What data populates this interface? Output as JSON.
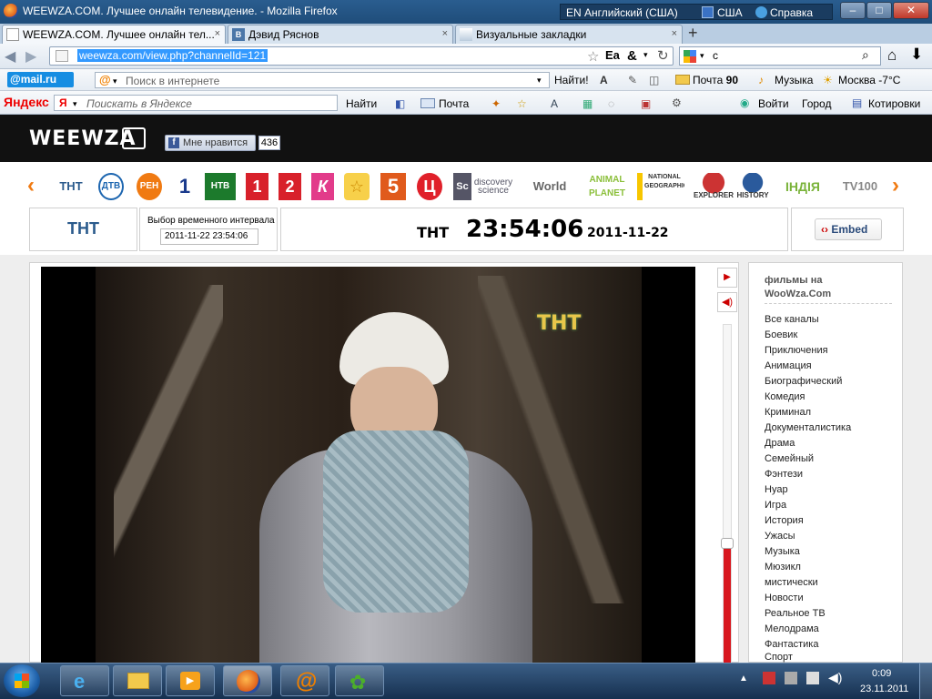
{
  "window": {
    "title": "WEEWZA.COM. Лучшее онлайн телевидение. - Mozilla Firefox",
    "lang_code": "EN",
    "lang_name": "Английский (США)",
    "region": "США",
    "help": "Справка",
    "minimize": "–",
    "maximize": "□",
    "close": "✕"
  },
  "tabs": [
    {
      "label": "WEEWZA.COM. Лучшее онлайн тел...",
      "icon": "page-icon"
    },
    {
      "label": "Дэвид Ряснов",
      "icon": "vk-icon"
    },
    {
      "label": "Визуальные закладки",
      "icon": "bookmarks-icon"
    }
  ],
  "tab_close": "×",
  "new_tab": "+",
  "nav": {
    "url": "weewza.com/view.php?channelId=121",
    "search_value": "c"
  },
  "mailbar": {
    "brand": "@mail.ru",
    "search_placeholder": "Поиск в интернете",
    "find": "Найти!",
    "mail": "Почта",
    "mail_count": "90",
    "music": "Музыка",
    "weather": "Москва -7°C"
  },
  "yabar": {
    "brand": "Яндекс",
    "search_placeholder": "Поискать в Яндексе",
    "find": "Найти",
    "mail": "Почта",
    "login": "Войти",
    "city": "Город",
    "quotes": "Котировки"
  },
  "site": {
    "logo": "WEEWZA",
    "like_label": "Мне нравится",
    "like_count": "436",
    "channels": [
      "ТНТ",
      "ДТВ",
      "РЕН",
      "1",
      "НТВ",
      "1",
      "2",
      "К",
      "☆",
      "5",
      "Ц",
      "Sc",
      "World",
      "ANIMAL PLANET",
      "NATIONAL GEOGRAPHIC",
      "EXPLORER",
      "HISTORY",
      "ІНДІЯ",
      "TV100"
    ],
    "channel_note": "discovery science",
    "current_channel_logo": "ТНТ",
    "interval_label": "Выбор временного интервала",
    "interval_value": "2011-11-22 23:54:06",
    "channel_name": "ТНТ",
    "time": "23:54:06",
    "date": "2011-11-22",
    "embed": "Embed",
    "watermark": "ТНТ"
  },
  "sidebar": {
    "title1": "фильмы на",
    "title2": "WooWza.Com",
    "genres": [
      "Все каналы",
      "Боевик",
      "Приключения",
      "Анимация",
      "Биографический",
      "Комедия",
      "Криминал",
      "Документалистика",
      "Драма",
      "Семейный",
      "Фэнтези",
      "Нуар",
      "Игра",
      "История",
      "Ужасы",
      "Музыка",
      "Мюзикл",
      "мистически",
      "Новости",
      "Реальное ТВ",
      "Мелодрама",
      "Фантастика",
      "Спорт"
    ]
  },
  "taskbar": {
    "time": "0:09",
    "date": "23.11.2011"
  }
}
